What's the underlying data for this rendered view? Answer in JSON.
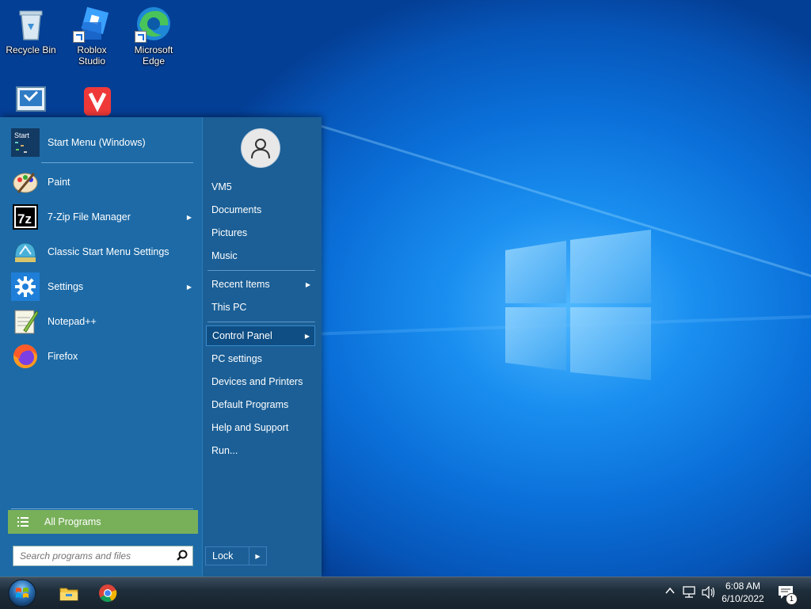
{
  "desktop": {
    "icons": [
      {
        "label": "Recycle Bin",
        "icon": "recycle-bin-icon"
      },
      {
        "label": "Roblox Studio",
        "icon": "roblox-studio-icon"
      },
      {
        "label": "Microsoft Edge",
        "icon": "edge-icon"
      },
      {
        "label": "",
        "icon": "control-panel-icon"
      },
      {
        "label": "",
        "icon": "vivaldi-icon"
      }
    ]
  },
  "start_menu": {
    "programs": [
      {
        "label": "Start Menu (Windows)",
        "icon": "start-menu-icon",
        "has_submenu": false
      },
      {
        "label": "Paint",
        "icon": "paint-icon",
        "has_submenu": false
      },
      {
        "label": "7-Zip File Manager",
        "icon": "seven-zip-icon",
        "has_submenu": true
      },
      {
        "label": "Classic Start Menu Settings",
        "icon": "classic-shell-icon",
        "has_submenu": false
      },
      {
        "label": "Settings",
        "icon": "gear-icon",
        "has_submenu": true
      },
      {
        "label": "Notepad++",
        "icon": "notepad-plus-plus-icon",
        "has_submenu": false
      },
      {
        "label": "Firefox",
        "icon": "firefox-icon",
        "has_submenu": false
      }
    ],
    "all_programs_label": "All Programs",
    "search_placeholder": "Search programs and files",
    "right_items": [
      {
        "label": "VM5",
        "has_submenu": false,
        "highlighted": false
      },
      {
        "label": "Documents",
        "has_submenu": false,
        "highlighted": false
      },
      {
        "label": "Pictures",
        "has_submenu": false,
        "highlighted": false
      },
      {
        "label": "Music",
        "has_submenu": false,
        "highlighted": false
      },
      {
        "label": "Recent Items",
        "has_submenu": true,
        "highlighted": false
      },
      {
        "label": "This PC",
        "has_submenu": false,
        "highlighted": false
      },
      {
        "label": "Control Panel",
        "has_submenu": true,
        "highlighted": true
      },
      {
        "label": "PC settings",
        "has_submenu": false,
        "highlighted": false
      },
      {
        "label": "Devices and Printers",
        "has_submenu": false,
        "highlighted": false
      },
      {
        "label": "Default Programs",
        "has_submenu": false,
        "highlighted": false
      },
      {
        "label": "Help and Support",
        "has_submenu": false,
        "highlighted": false
      },
      {
        "label": "Run...",
        "has_submenu": false,
        "highlighted": false
      }
    ],
    "lock_label": "Lock",
    "submenu_arrow": "▶",
    "start_icon_text": "Start"
  },
  "taskbar": {
    "pinned": [
      {
        "icon": "file-explorer-icon"
      },
      {
        "icon": "chrome-icon"
      }
    ],
    "time": "6:08 AM",
    "date": "6/10/2022",
    "notification_count": "1"
  },
  "colors": {
    "menu_left": "#1d6aa6",
    "menu_right": "#1b5f96",
    "all_programs": "#78b05a",
    "highlight": "#0e4e84"
  }
}
